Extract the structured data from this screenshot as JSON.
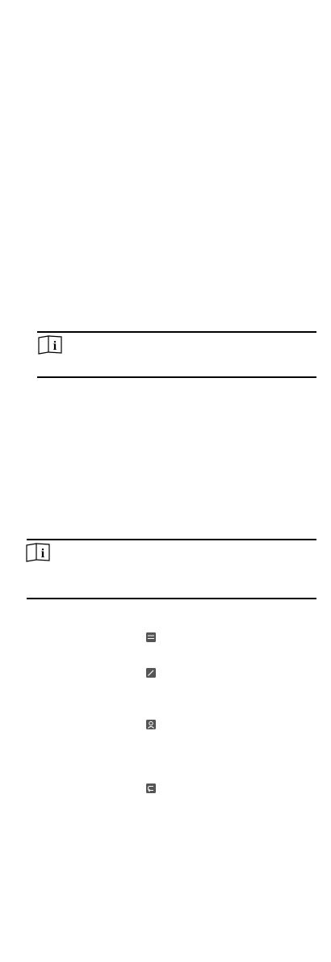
{
  "notes": [
    {
      "icon": "note-book-icon",
      "label": "i"
    },
    {
      "icon": "note-book-icon",
      "label": "i"
    }
  ],
  "menu_icons": [
    "card-icon",
    "edit-icon",
    "user-icon",
    "return-icon"
  ],
  "colors": {
    "rule": "#000000",
    "icon_fill": "#555555",
    "icon_stroke": "#ffffff"
  }
}
